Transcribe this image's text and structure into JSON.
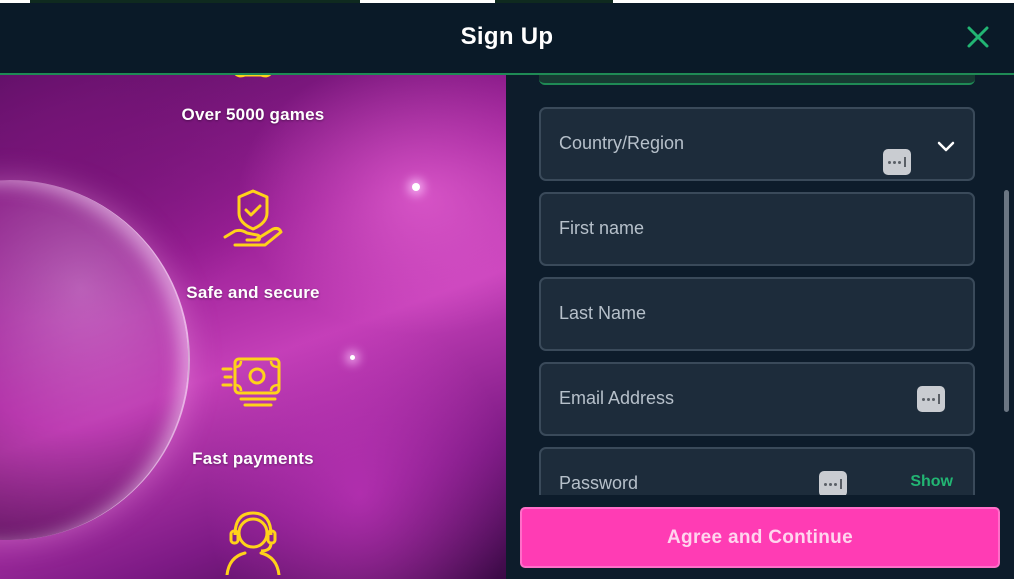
{
  "header": {
    "title": "Sign Up"
  },
  "features": [
    {
      "label": "Over 5000 games",
      "icon": "controller-icon"
    },
    {
      "label": "Safe and secure",
      "icon": "shield-hand-icon"
    },
    {
      "label": "Fast payments",
      "icon": "cash-icon"
    },
    {
      "label": "",
      "icon": "support-agent-icon"
    }
  ],
  "form": {
    "country": {
      "placeholder": "Country/Region"
    },
    "first_name": {
      "placeholder": "First name"
    },
    "last_name": {
      "placeholder": "Last Name"
    },
    "email": {
      "placeholder": "Email Address"
    },
    "password": {
      "placeholder": "Password",
      "show_label": "Show"
    }
  },
  "cta": {
    "label": "Agree and Continue"
  },
  "colors": {
    "accent_green": "#22b573",
    "cta_pink": "#ff3cb4",
    "icon_yellow": "#ffd21a",
    "field_bg": "#1d2c3b"
  }
}
